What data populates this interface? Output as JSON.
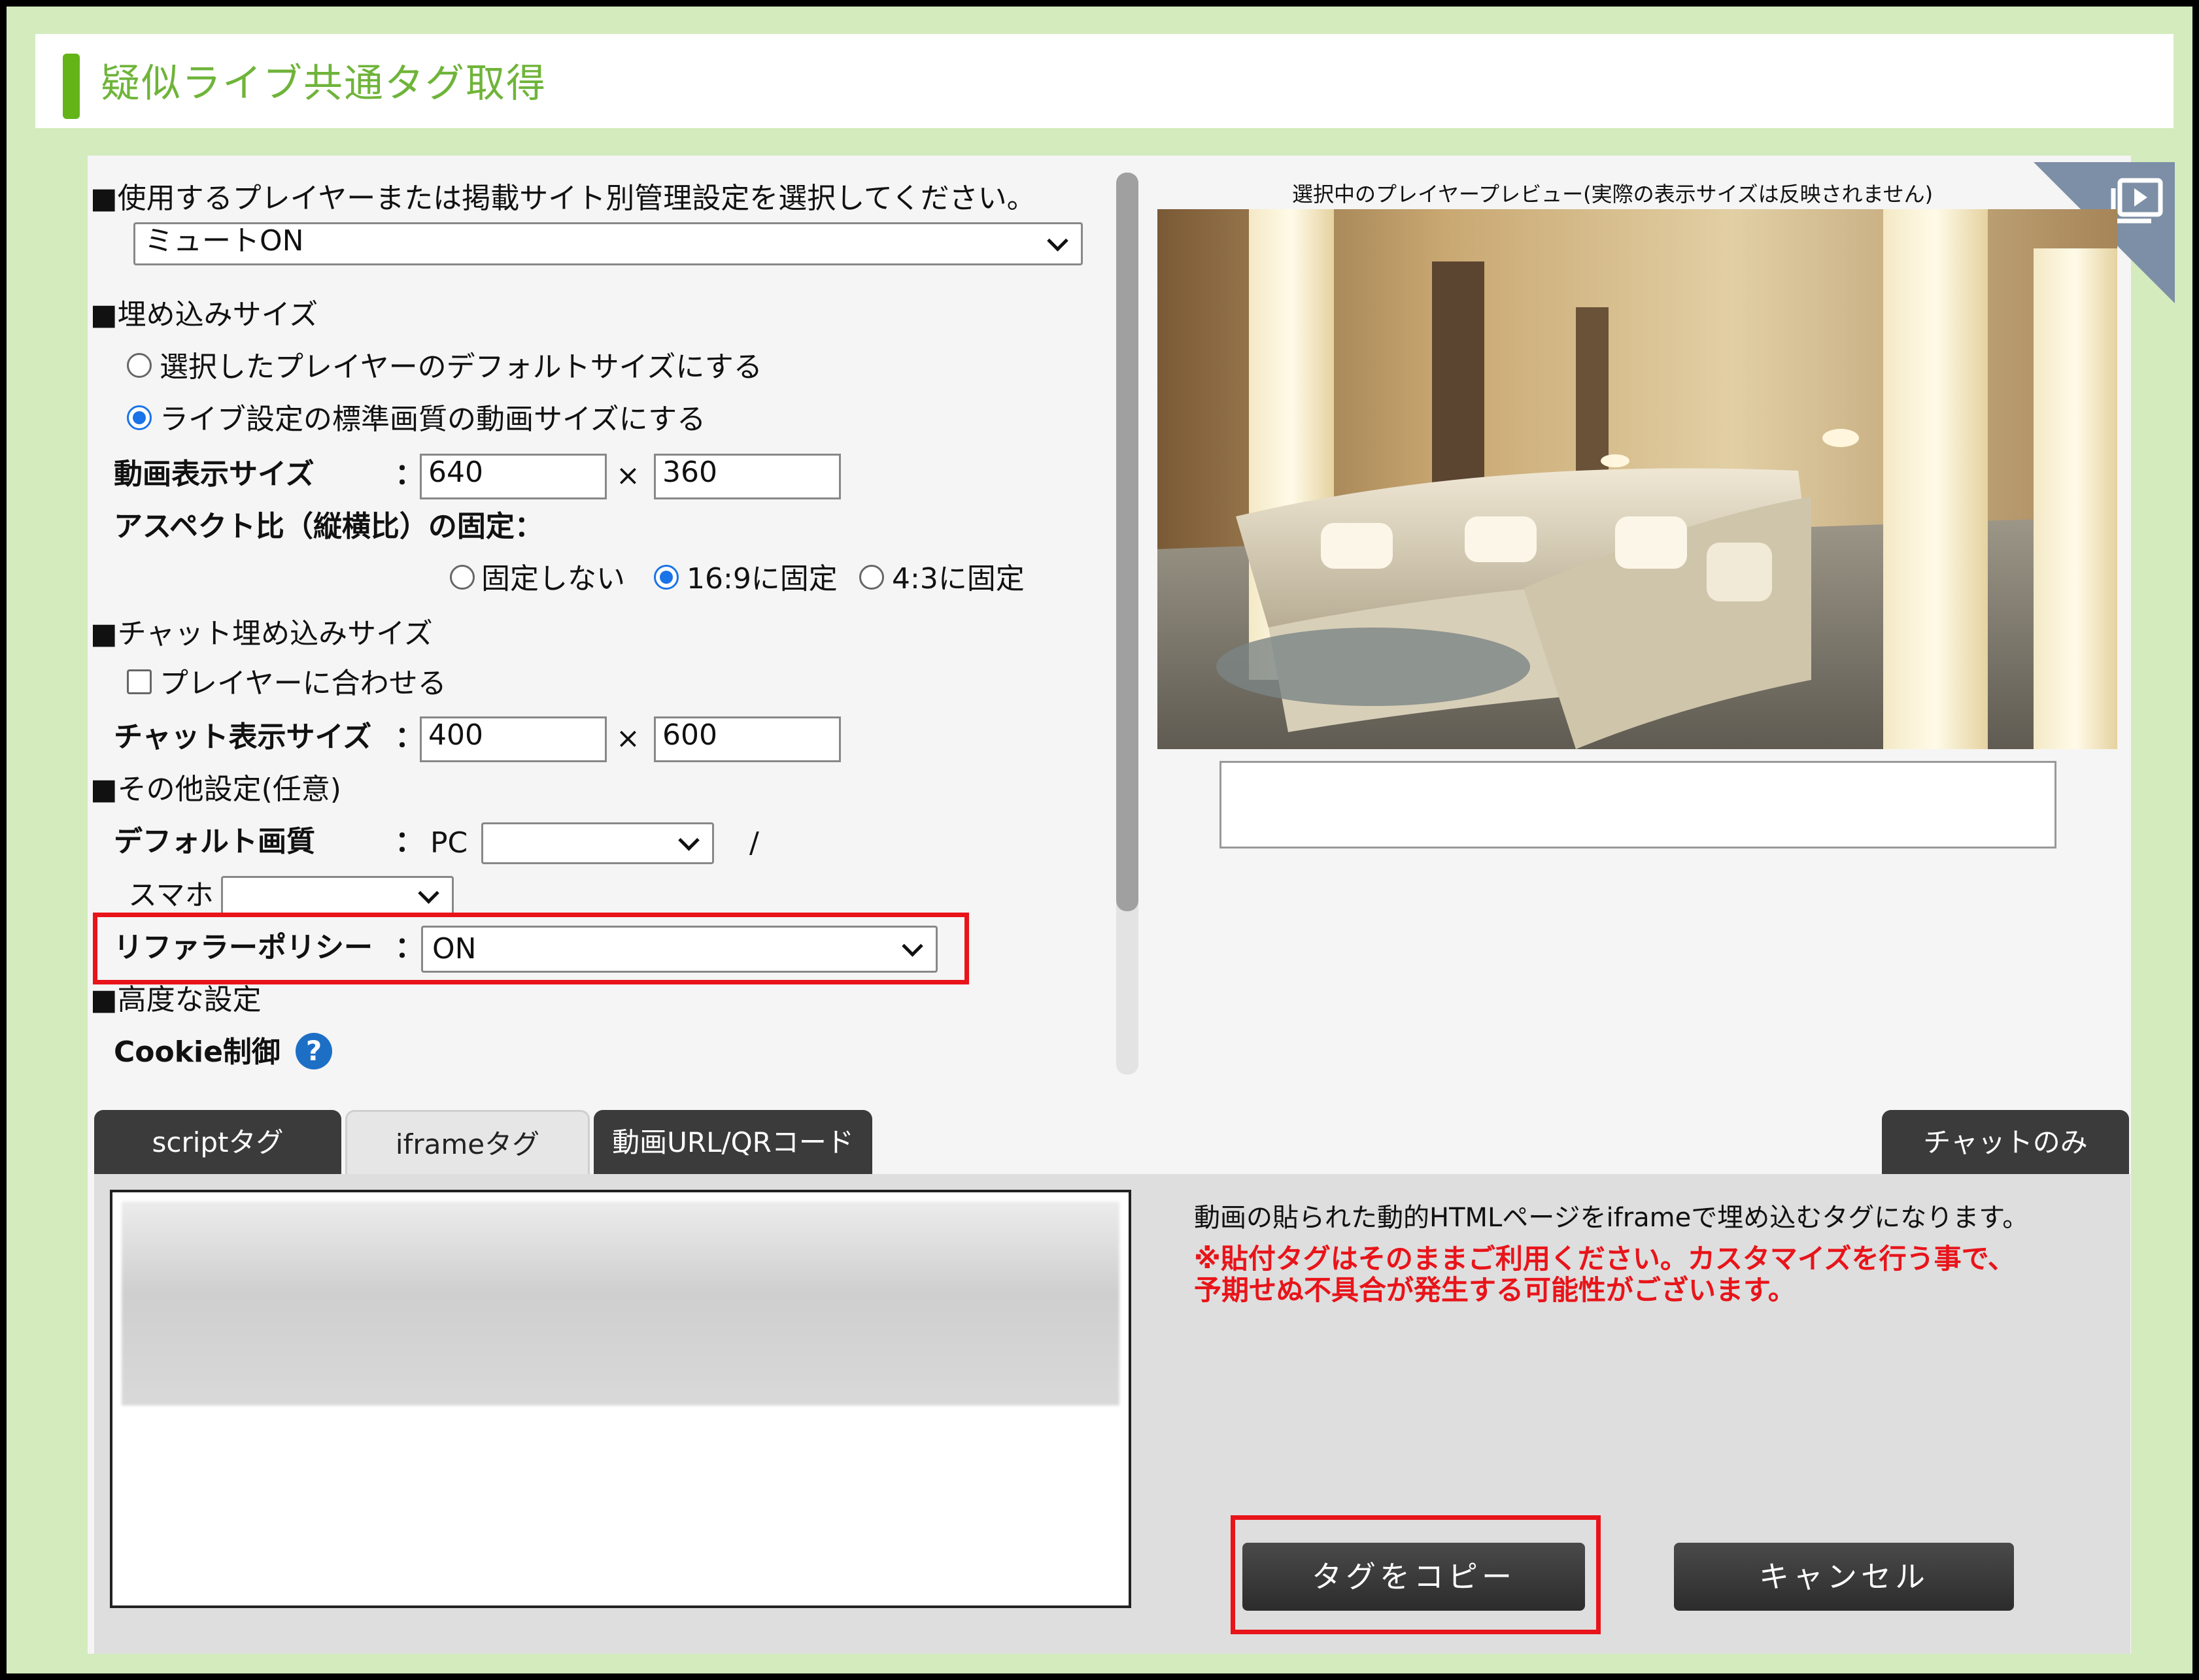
{
  "page": {
    "title": "疑似ライブ共通タグ取得"
  },
  "player": {
    "heading": "■使用するプレイヤーまたは掲載サイト別管理設定を選択してください。",
    "selected": "ミュートON"
  },
  "embed_size": {
    "heading": "■埋め込みサイズ",
    "option_default": "選択したプレイヤーのデフォルトサイズにする",
    "option_live": "ライブ設定の標準画質の動画サイズにする",
    "video_size_label": "動画表示サイズ",
    "colon": "：",
    "width": "640",
    "times": "×",
    "height": "360",
    "aspect_label": "アスペクト比（縦横比）の固定：",
    "aspect_none": "固定しない",
    "aspect_169": "16:9に固定",
    "aspect_43": "4:3に固定"
  },
  "chat_size": {
    "heading": "■チャット埋め込みサイズ",
    "fit_player": "プレイヤーに合わせる",
    "label": "チャット表示サイズ",
    "width": "400",
    "height": "600"
  },
  "other": {
    "heading": "■その他設定(任意)",
    "default_quality_label": "デフォルト画質",
    "pc_label": "PC",
    "slash": "/",
    "smartphone_label": "スマホ",
    "referrer_label": "リファラーポリシー",
    "referrer_value": "ON"
  },
  "advanced": {
    "heading": "■高度な設定",
    "cookie_label": "Cookie制御",
    "help": "?"
  },
  "preview": {
    "caption": "選択中のプレイヤープレビュー(実際の表示サイズは反映されません)"
  },
  "tabs": {
    "script": "scriptタグ",
    "iframe": "iframeタグ",
    "url_qr": "動画URL/QRコード",
    "chat_only": "チャットのみ"
  },
  "tag_info": {
    "description": "動画の貼られた動的HTMLページをiframeで埋め込むタグになります。",
    "warning_line1": "※貼付タグはそのままご利用ください。カスタマイズを行う事で、",
    "warning_line2": "予期せぬ不具合が発生する可能性がございます。"
  },
  "buttons": {
    "copy": "タグをコピー",
    "cancel": "キャンセル"
  },
  "colors": {
    "frame_green": "#d4ebbd",
    "title_green": "#6fb43a",
    "highlight_red": "#e8141a",
    "radio_blue": "#1a73e8"
  }
}
